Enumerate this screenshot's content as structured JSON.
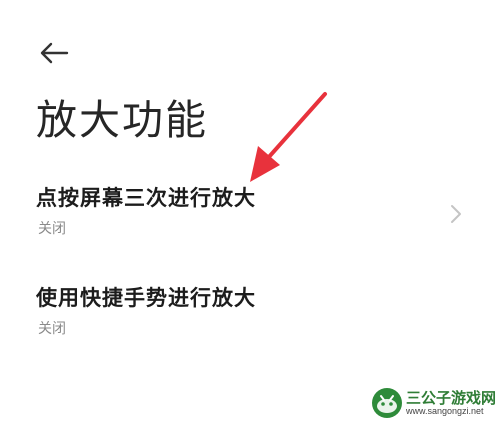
{
  "header": {
    "back_icon": "arrow-left-icon",
    "title": "放大功能"
  },
  "settings": {
    "items": [
      {
        "label": "点按屏幕三次进行放大",
        "status": "关闭",
        "icon": "chevron-right-icon"
      },
      {
        "label": "使用快捷手势进行放大",
        "status": "关闭"
      }
    ]
  },
  "annotation": {
    "arrow_color": "#e8323c"
  },
  "watermark": {
    "title": "三公子游戏网",
    "url": "www.sangongzi.net",
    "color": "#2f7d36"
  }
}
